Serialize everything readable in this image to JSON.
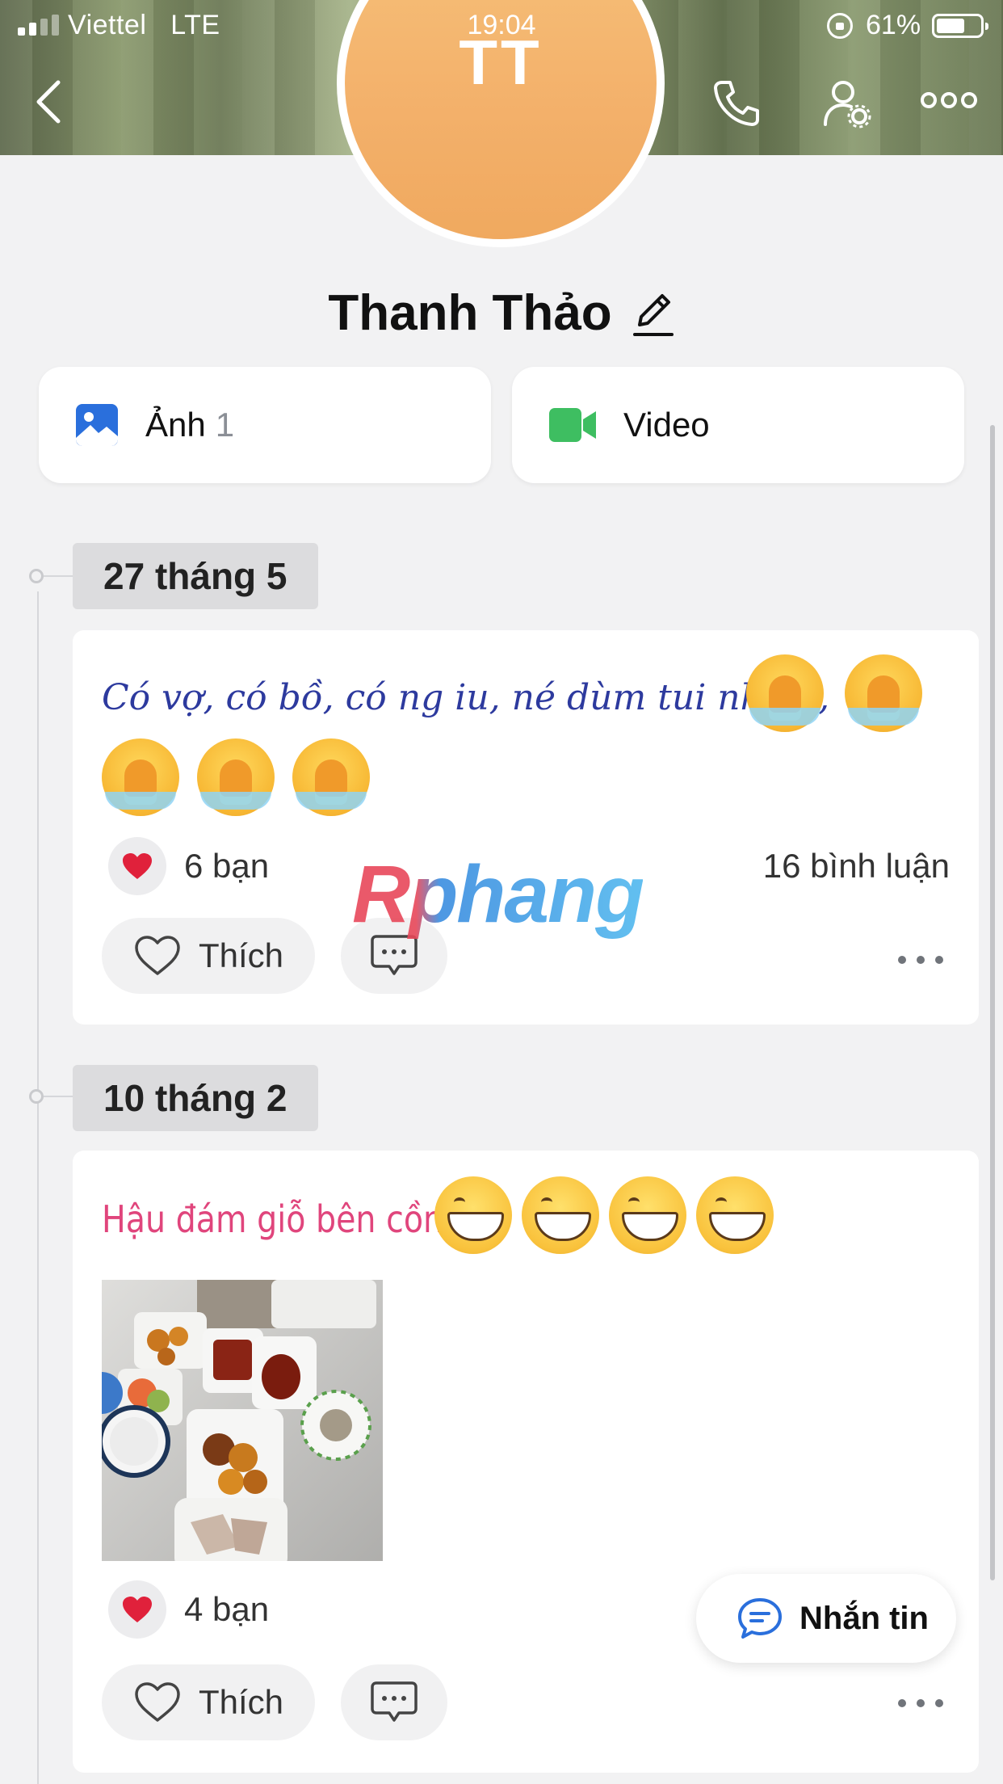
{
  "status_bar": {
    "carrier": "Viettel",
    "network": "LTE",
    "time": "19:04",
    "battery": "61%"
  },
  "header": {
    "back_icon": "chevron-left-icon",
    "call_icon": "phone-icon",
    "settings_icon": "user-gear-icon",
    "more_icon": "more-horizontal-icon"
  },
  "profile": {
    "initials": "TT",
    "name": "Thanh Thảo",
    "edit_icon": "pencil-icon",
    "avatar_color": "#f3b06a"
  },
  "media": {
    "photos_label": "Ảnh",
    "photos_count": "1",
    "videos_label": "Video"
  },
  "posts": [
    {
      "date": "27 tháng 5",
      "text": "Có vợ, có bồ, có ng iu, né dùm tui nha,,,,",
      "emoji": "crying-face",
      "emoji_count": 5,
      "likes": "6 bạn",
      "comments": "16 bình luận",
      "like_label": "Thích"
    },
    {
      "date": "10 tháng 2",
      "text": "Hậu đám giỗ bên cồn",
      "emoji": "grinning-face",
      "emoji_count": 4,
      "likes": "4 bạn",
      "like_label": "Thích"
    }
  ],
  "watermark": "Rphang",
  "fab": {
    "label": "Nhắn tin",
    "icon": "chat-bubble-icon"
  },
  "colors": {
    "accent_blue": "#2a6fdc",
    "video_green": "#3ebe61",
    "post1_text": "#2d3a9e",
    "post2_text": "#e0457c",
    "heart": "#e0213b"
  }
}
